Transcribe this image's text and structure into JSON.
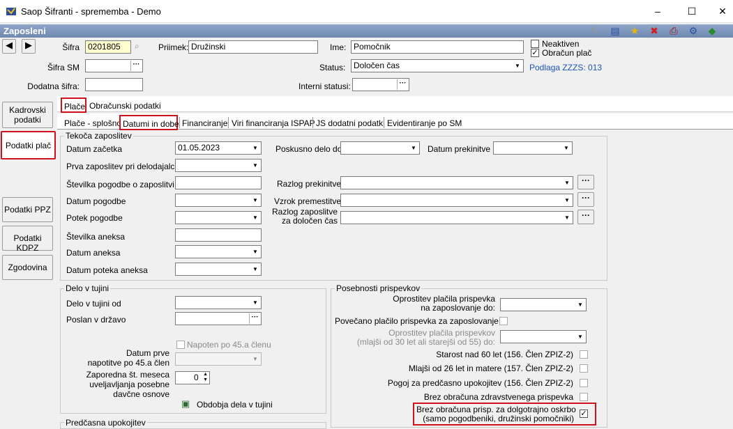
{
  "window": {
    "title": "Saop Šifranti - sprememba - Demo",
    "min": "–",
    "max": "☐",
    "close": "✕"
  },
  "header": {
    "title": "Zaposleni"
  },
  "top": {
    "sifra_label": "Šifra",
    "sifra_value": "0201805",
    "priimek_label": "Priimek:",
    "priimek_value": "Družinski",
    "ime_label": "Ime:",
    "ime_value": "Pomočnik",
    "neaktiven_label": "Neaktiven",
    "obracun_label": "Obračun plač",
    "obracun_check": "✓",
    "sifra_sm_label": "Šifra SM",
    "status_label": "Status:",
    "status_value": "Določen čas",
    "podlaga": "Podlaga ZZZS: 013",
    "dodatna_label": "Dodatna šifra:",
    "interni_label": "Interni statusi:",
    "dots": "···"
  },
  "sidebar": [
    "Kadrovski podatki",
    "Podatki plač",
    "Podatki PPZ",
    "Podatki KDPZ",
    "Zgodovina"
  ],
  "tabs1": [
    "Plače",
    "Obračunski podatki"
  ],
  "tabs2": [
    "Plače - splošno",
    "Datumi in dobe",
    "Financiranje",
    "Viri financiranja ISPAP",
    "JS dodatni podatki",
    "Evidentiranje po SM"
  ],
  "tekoca": {
    "title": "Tekoča zaposlitev",
    "datum_zacetka": "Datum začetka",
    "datum_zacetka_value": "01.05.2023",
    "prva": "Prva zaposlitev pri delodajalcu",
    "stevilka_pogodbe": "Številka pogodbe o zaposlitvi",
    "datum_pogodbe": "Datum pogodbe",
    "potek_pogodbe": "Potek pogodbe",
    "stevilka_aneksa": "Številka aneksa",
    "datum_aneksa": "Datum aneksa",
    "datum_poteka_aneksa": "Datum poteka aneksa",
    "poskusno": "Poskusno delo do",
    "datum_prekinitve": "Datum prekinitve",
    "razlog_prekinitve": "Razlog prekinitve",
    "vzrok": "Vzrok premestitve",
    "razlog_zap1": "Razlog zaposlitve",
    "razlog_zap2": "za določen čas"
  },
  "tujina": {
    "title": "Delo v tujini",
    "od": "Delo v tujini od",
    "poslan": "Poslan v državo",
    "napoten": "Napoten po 45.a členu",
    "datum_prve1": "Datum prve",
    "datum_prve2": "napotitve po 45.a člen",
    "zap1": "Zaporedna št. meseca",
    "zap2": "uveljavljanja posebne",
    "zap3": "davčne osnove",
    "zap_value": "0",
    "obdobja": "Obdobja dela v tujini"
  },
  "posebnosti": {
    "title": "Posebnosti prispevkov",
    "opr1": "Oprostitev plačila prispevka",
    "opr2": "na zaposlovanje do:",
    "povecano": "Povečano plačilo prispevka za zaposlovanje",
    "opr3": "Oprostitev plačila prispevkov",
    "opr4": "(mlajši od 30 let ali starejši od 55) do:",
    "starost": "Starost nad 60 let (156. Člen ZPIZ-2)",
    "mlajsi": "Mlajši od 26 let in matere (157. Člen ZPIZ-2)",
    "pogoj": "Pogoj za predčasno upokojitev (156. Člen ZPIZ-2)",
    "brez_zdr": "Brez obračuna zdravstvenega prispevka",
    "brez_dolg1": "Brez obračuna prisp. za dolgotrajno oskrbo",
    "brez_dolg2": "(samo pogodbeniki, družinski pomočniki)",
    "check": "✓"
  },
  "predcasna": {
    "title": "Predčasna upokojitev"
  }
}
